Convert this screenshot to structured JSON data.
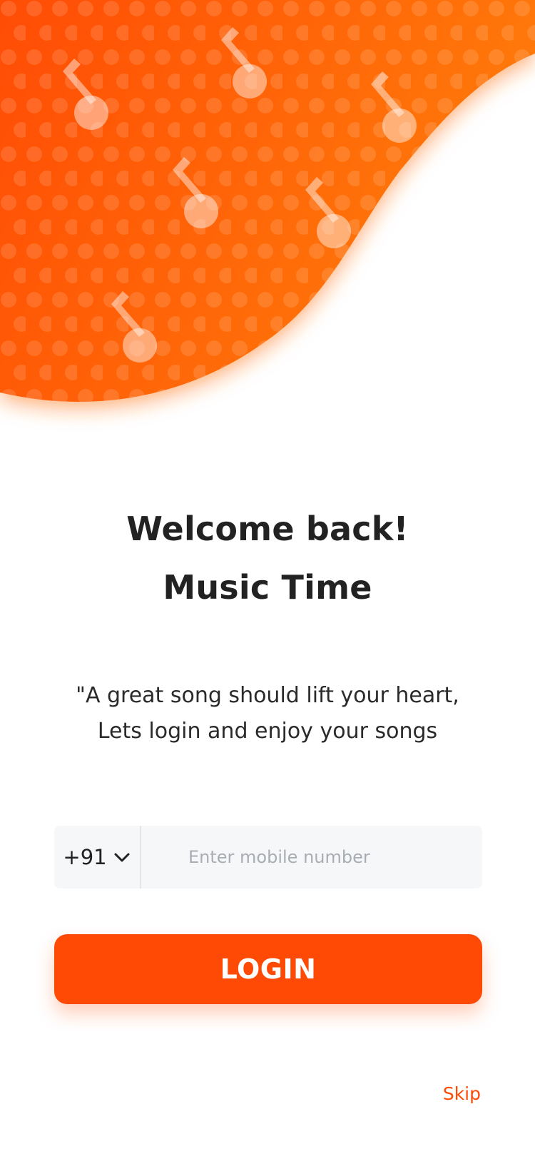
{
  "hero": {
    "colors": {
      "start": "#ff4a06",
      "end": "#ff7a0a"
    },
    "icon": "music-note-icon"
  },
  "welcome": {
    "line1": "Welcome back!",
    "line2": "Music Time"
  },
  "tagline": {
    "line1": "\"A great song should lift your heart,",
    "line2": "Lets login and enjoy your songs"
  },
  "phone": {
    "country_code": "+91",
    "chevron_icon": "chevron-down-icon",
    "placeholder": "Enter mobile number",
    "value": ""
  },
  "login": {
    "label": "LOGIN",
    "color": "#ff4a06"
  },
  "skip": {
    "label": "Skip"
  }
}
